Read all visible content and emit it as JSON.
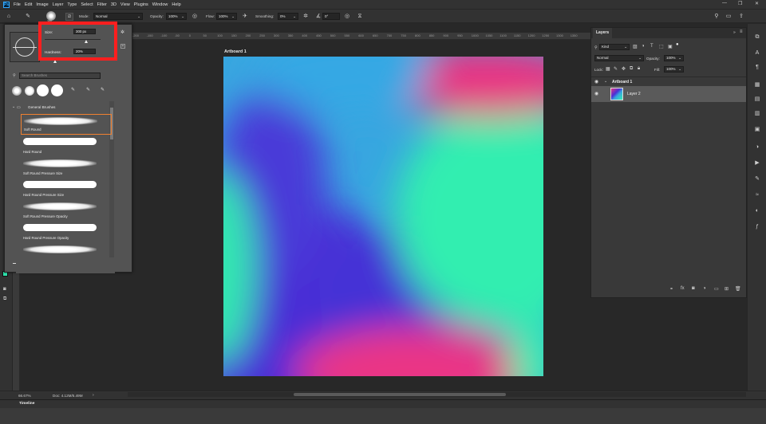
{
  "menu": {
    "items": [
      "File",
      "Edit",
      "Image",
      "Layer",
      "Type",
      "Select",
      "Filter",
      "3D",
      "View",
      "Plugins",
      "Window",
      "Help"
    ]
  },
  "options": {
    "brush_size_badge": "300",
    "mode_label": "Mode:",
    "mode_value": "Normal",
    "opacity_label": "Opacity:",
    "opacity_value": "100%",
    "flow_label": "Flow:",
    "flow_value": "100%",
    "smoothing_label": "Smoothing:",
    "smoothing_value": "0%",
    "angle_value": "0°"
  },
  "brush_panel": {
    "size_label": "Size:",
    "size_value": "300 px",
    "hardness_label": "Hardness:",
    "hardness_value": "20%",
    "search_placeholder": "Search Brushes",
    "group_label": "General Brushes",
    "brushes": [
      {
        "name": "Soft Round",
        "hard": false
      },
      {
        "name": "Hard Round",
        "hard": true
      },
      {
        "name": "Soft Round Pressure Size",
        "hard": false
      },
      {
        "name": "Hard Round Pressure Size",
        "hard": true
      },
      {
        "name": "Soft Round Pressure Opacity",
        "hard": false
      },
      {
        "name": "Hard Round Pressure Opacity",
        "hard": true
      },
      {
        "name": "",
        "hard": false
      }
    ]
  },
  "ruler_ticks": [
    "-200",
    "-150",
    "-100",
    "-50",
    "0",
    "50",
    "100",
    "150",
    "200",
    "250",
    "300",
    "350",
    "400",
    "450",
    "500",
    "550",
    "600",
    "650",
    "700",
    "750",
    "800",
    "850",
    "900",
    "950",
    "1000",
    "1050",
    "1100",
    "1150",
    "1200",
    "1250",
    "1300",
    "1350"
  ],
  "canvas": {
    "artboard_title": "Artboard 1"
  },
  "status": {
    "zoom": "66.67%",
    "doc": "Doc: 4.12M/5.49M",
    "timeline": "Timeline"
  },
  "layers": {
    "panel_title": "Layers",
    "filter_kind": "Kind",
    "blend_mode": "Normal",
    "opacity_label": "Opacity:",
    "opacity_value": "100%",
    "lock_label": "Lock:",
    "fill_label": "Fill:",
    "fill_value": "100%",
    "rows": [
      {
        "name": "Artboard 1",
        "type": "artboard"
      },
      {
        "name": "Layer 2",
        "type": "layer"
      }
    ]
  },
  "colors": {
    "foreground": "#2ee8b0",
    "background": "#ffffff",
    "highlight": "#ff1f1f",
    "selected_brush_border": "#f08030"
  }
}
